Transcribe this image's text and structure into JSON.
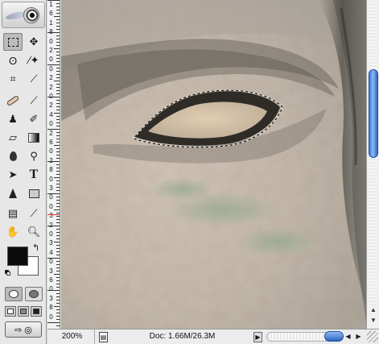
{
  "toolbox": {
    "tools": [
      {
        "name": "rectangular-marquee-tool",
        "icon": "marquee-icon",
        "active": true
      },
      {
        "name": "move-tool",
        "icon": "move-icon"
      },
      {
        "name": "lasso-tool",
        "icon": "lasso-icon"
      },
      {
        "name": "magic-wand-tool",
        "icon": "magic-wand-icon"
      },
      {
        "name": "crop-tool",
        "icon": "crop-icon"
      },
      {
        "name": "slice-tool",
        "icon": "slice-icon"
      },
      {
        "name": "healing-brush-tool",
        "icon": "bandage-icon"
      },
      {
        "name": "brush-tool",
        "icon": "brush-icon"
      },
      {
        "name": "clone-stamp-tool",
        "icon": "stamp-icon"
      },
      {
        "name": "history-brush-tool",
        "icon": "history-brush-icon"
      },
      {
        "name": "eraser-tool",
        "icon": "eraser-icon"
      },
      {
        "name": "gradient-tool",
        "icon": "gradient-icon"
      },
      {
        "name": "blur-tool",
        "icon": "drop-icon"
      },
      {
        "name": "dodge-tool",
        "icon": "dodge-icon"
      },
      {
        "name": "path-selection-tool",
        "icon": "arrow-icon"
      },
      {
        "name": "type-tool",
        "icon": "type-icon",
        "label": "T"
      },
      {
        "name": "pen-tool",
        "icon": "pen-icon"
      },
      {
        "name": "rectangle-tool",
        "icon": "rectangle-icon"
      },
      {
        "name": "notes-tool",
        "icon": "notes-icon"
      },
      {
        "name": "eyedropper-tool",
        "icon": "eyedropper-icon"
      },
      {
        "name": "hand-tool",
        "icon": "hand-icon"
      },
      {
        "name": "zoom-tool",
        "icon": "zoom-icon"
      }
    ],
    "foreground_color": "#0b0b0b",
    "background_color": "#ffffff"
  },
  "ruler": {
    "labels": [
      "1",
      "6",
      "1",
      "8",
      "0",
      "2",
      "0",
      "0",
      "2",
      "2",
      "0",
      "2",
      "4",
      "0",
      "2",
      "6",
      "0",
      "2",
      "8",
      "0",
      "3",
      "0",
      "0",
      "3",
      "2",
      "0",
      "3",
      "4",
      "0",
      "3",
      "6",
      "0",
      "3",
      "8",
      "0"
    ]
  },
  "status": {
    "zoom": "200%",
    "doc_info": "Doc: 1.66M/26.3M"
  }
}
